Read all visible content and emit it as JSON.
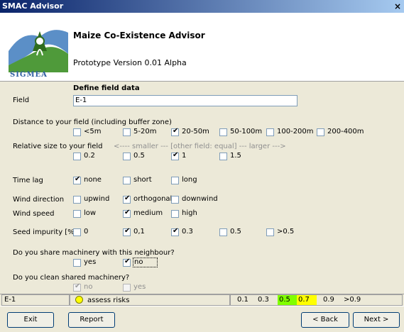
{
  "window": {
    "title": "SMAC Advisor",
    "close": "×"
  },
  "header": {
    "logo_text": "SIGMEA",
    "app_title": "Maize Co-Existence Advisor",
    "version": "Prototype Version 0.01 Alpha"
  },
  "field_section": {
    "heading": "Define field data",
    "field_label": "Field",
    "field_value": "E-1"
  },
  "distance": {
    "label": "Distance to your field (including buffer zone)",
    "options": [
      {
        "label": "<5m",
        "checked": false
      },
      {
        "label": "5-20m",
        "checked": false
      },
      {
        "label": "20-50m",
        "checked": true
      },
      {
        "label": "50-100m",
        "checked": false
      },
      {
        "label": "100-200m",
        "checked": false
      },
      {
        "label": "200-400m",
        "checked": false
      }
    ]
  },
  "relsize": {
    "label": "Relative size to your field",
    "hint": "<---- smaller ---  [other field: equal]  --- larger --->",
    "options": [
      {
        "label": "0.2",
        "checked": false
      },
      {
        "label": "0.5",
        "checked": false
      },
      {
        "label": "1",
        "checked": true
      },
      {
        "label": "1.5",
        "checked": false
      }
    ]
  },
  "timelag": {
    "label": "Time lag",
    "options": [
      {
        "label": "none",
        "checked": true
      },
      {
        "label": "short",
        "checked": false
      },
      {
        "label": "long",
        "checked": false
      }
    ]
  },
  "winddir": {
    "label": "Wind direction",
    "options": [
      {
        "label": "upwind",
        "checked": false
      },
      {
        "label": "orthogonal",
        "checked": true
      },
      {
        "label": "downwind",
        "checked": false
      }
    ]
  },
  "windspeed": {
    "label": "Wind speed",
    "options": [
      {
        "label": "low",
        "checked": false
      },
      {
        "label": "medium",
        "checked": true
      },
      {
        "label": "high",
        "checked": false
      }
    ]
  },
  "seed": {
    "label": "Seed impurity [%]",
    "options": [
      {
        "label": "0",
        "checked": false
      },
      {
        "label": "0,1",
        "checked": true
      },
      {
        "label": "0.3",
        "checked": true
      },
      {
        "label": "0.5",
        "checked": false
      },
      {
        "label": ">0.5",
        "checked": false
      }
    ]
  },
  "share": {
    "question": "Do you share machinery with this neighbour?",
    "options": [
      {
        "label": "yes",
        "checked": false
      },
      {
        "label": "no",
        "checked": true
      }
    ]
  },
  "clean": {
    "question": "Do you clean shared machinery?",
    "options": [
      {
        "label": "no",
        "checked": true
      },
      {
        "label": "yes",
        "checked": false
      }
    ]
  },
  "status": {
    "field": "E-1",
    "assess": "assess risks",
    "indicator_color": "#ffff00",
    "scale": [
      {
        "label": "0.1",
        "color": ""
      },
      {
        "label": "0.3",
        "color": ""
      },
      {
        "label": "0.5",
        "color": "#80ff00"
      },
      {
        "label": "0.7",
        "color": "#ffff00"
      },
      {
        "label": "0.9",
        "color": ""
      },
      {
        "label": ">0.9",
        "color": ""
      }
    ]
  },
  "buttons": {
    "exit": "Exit",
    "report": "Report",
    "back": "< Back",
    "next": "Next >"
  },
  "colors": {
    "title_bar": "#0a246a",
    "dialog_bg": "#ece9d8",
    "scale_green": "#80ff00",
    "scale_yellow": "#ffff00"
  }
}
